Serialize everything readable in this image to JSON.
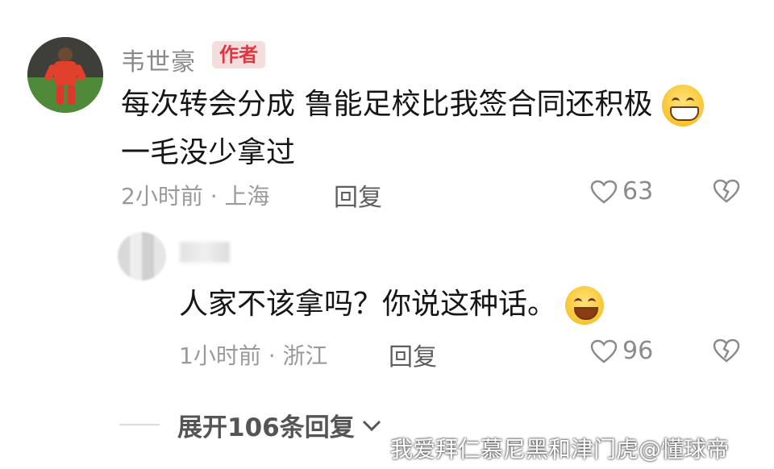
{
  "top_comment": {
    "author_name": "韦世豪",
    "author_badge": "作者",
    "text": "每次转会分成 鲁能足校比我签合同还积极",
    "text_line2": "一毛没少拿过",
    "time_location": "2小时前 · 上海",
    "reply_label": "回复",
    "like_count": "63"
  },
  "reply_comment": {
    "text": "人家不该拿吗？你说这种话。",
    "time_location": "1小时前 · 浙江",
    "reply_label": "回复",
    "like_count": "96"
  },
  "expand_replies": {
    "label": "展开106条回复"
  },
  "watermark": "我爱拜仁慕尼黑和津门虎@懂球帝",
  "icons": {
    "like": "heart-outline-icon",
    "dislike": "broken-heart-icon",
    "expand": "chevron-down-icon"
  },
  "colors": {
    "badge_text": "#e0363f",
    "badge_bg": "#f3dedd",
    "meta": "#9a9a9a"
  }
}
